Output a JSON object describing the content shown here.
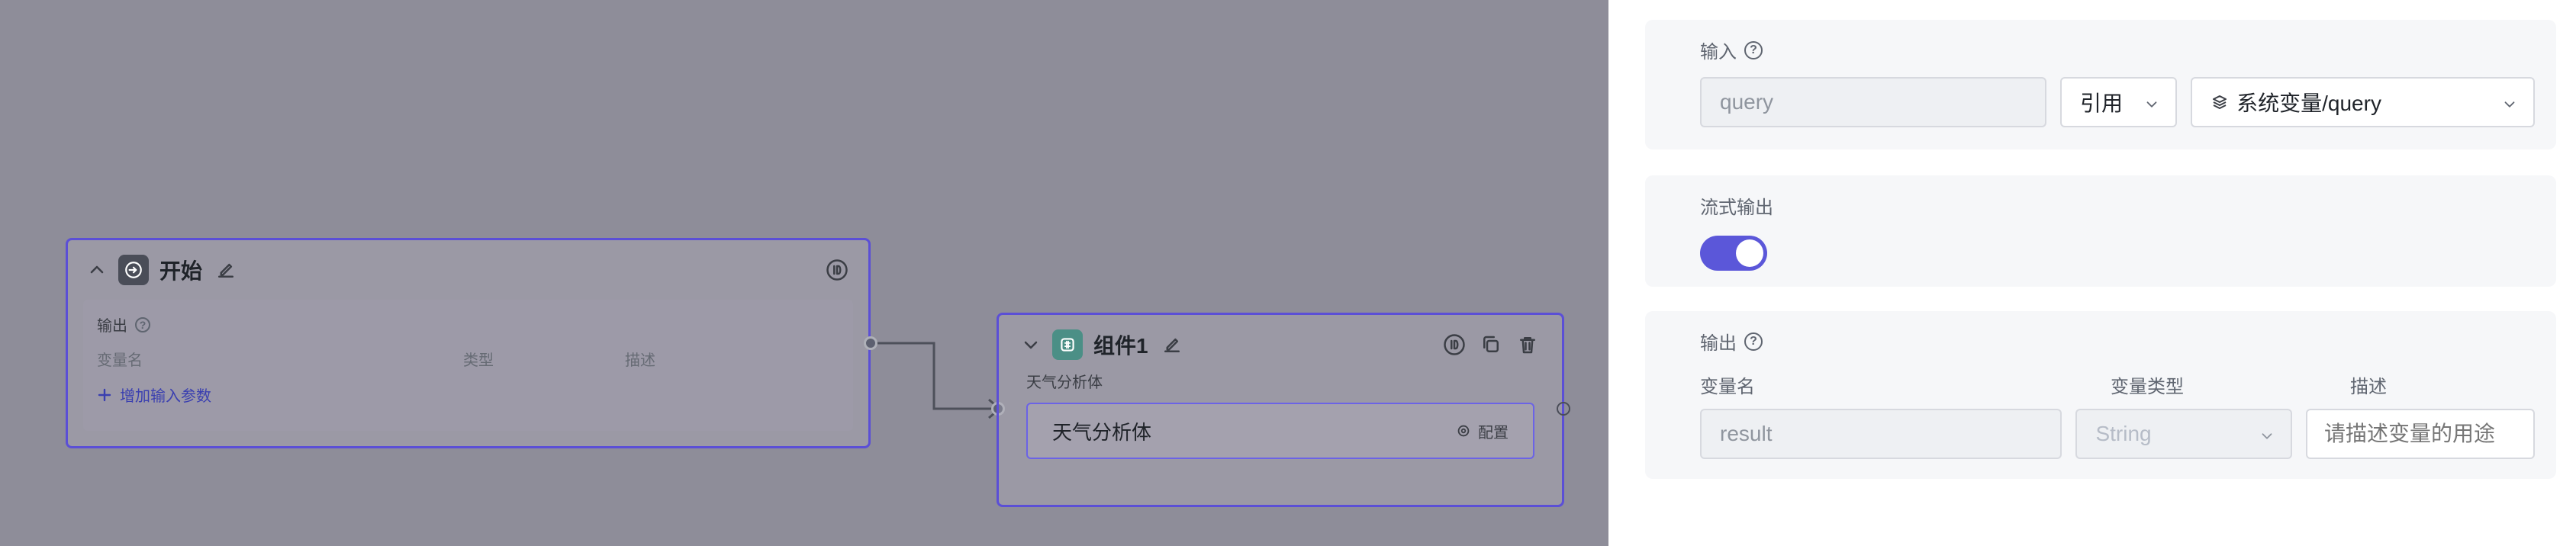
{
  "canvas": {
    "start_node": {
      "title": "开始",
      "output_label": "输出",
      "columns": [
        "变量名",
        "类型",
        "描述"
      ],
      "add_param_label": "增加输入参数"
    },
    "component_node": {
      "title": "组件1",
      "subtitle": "天气分析体",
      "card_title": "天气分析体",
      "card_action": "配置"
    }
  },
  "panel": {
    "input_section": {
      "label": "输入",
      "param_value": "query",
      "mode_value": "引用",
      "reference_value": "系统变量/query"
    },
    "stream_section": {
      "label": "流式输出",
      "enabled": true
    },
    "output_section": {
      "label": "输出",
      "col_name": "变量名",
      "col_type": "变量类型",
      "col_desc": "描述",
      "name_value": "result",
      "type_value": "String",
      "desc_placeholder": "请描述变量的用途"
    }
  },
  "colors": {
    "accent": "#5b4fd6",
    "toggle": "#5b57d9"
  }
}
